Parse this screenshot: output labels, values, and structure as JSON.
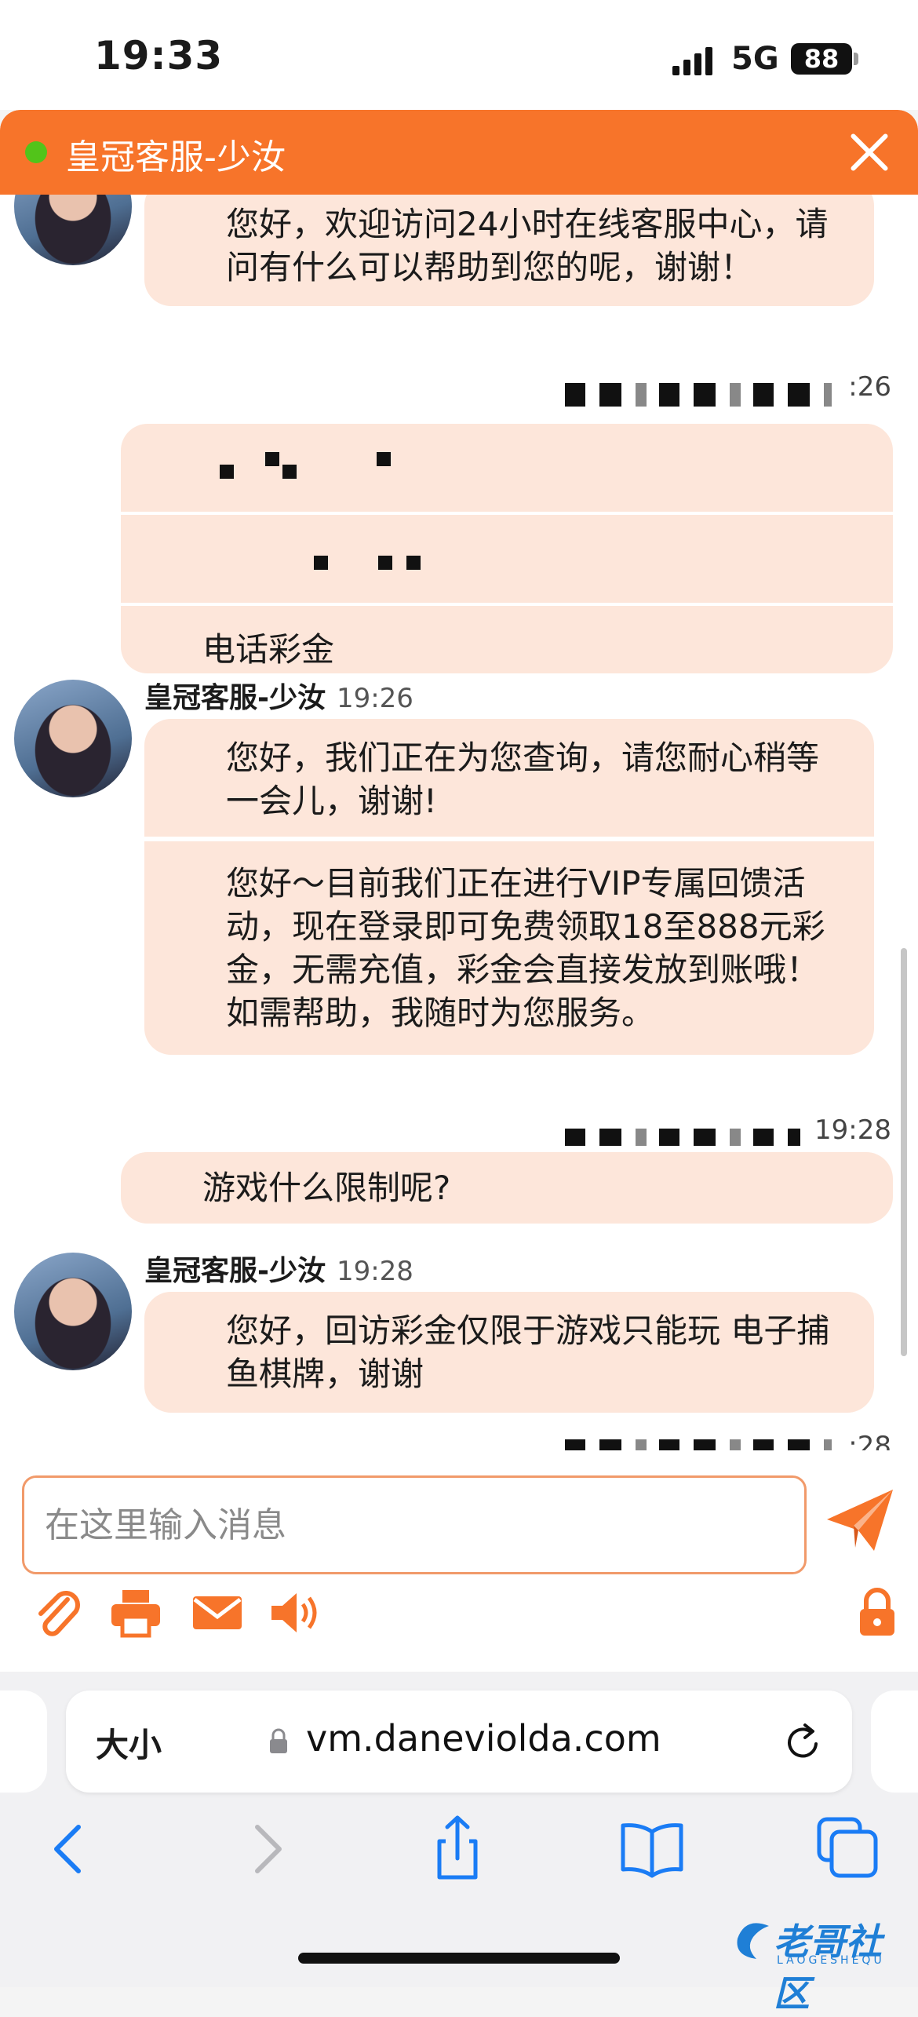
{
  "status_bar": {
    "time": "19:33",
    "network": "5G",
    "battery": "88"
  },
  "chat": {
    "header_title": "皇冠客服-少汝",
    "messages": {
      "agent_greeting": "您好，欢迎访问24小时在线客服中心，请问有什么可以帮助到您的呢，谢谢！",
      "user1_time_partial": ":26",
      "user1_text": "电话彩金",
      "agent2_name": "皇冠客服-少汝",
      "agent2_time": "19:26",
      "agent2_text1": "您好，我们正在为您查询，请您耐心稍等一会儿，谢谢!",
      "agent2_text2": "您好～目前我们正在进行VIP专属回馈活动，现在登录即可免费领取18至888元彩金，无需充值，彩金会直接发放到账哦！如需帮助，我随时为您服务。",
      "user2_time": "19:28",
      "user2_text": "游戏什么限制呢?",
      "agent3_name": "皇冠客服-少汝",
      "agent3_time": "19:28",
      "agent3_text": "您好，回访彩金仅限于游戏只能玩 电子捕鱼棋牌，谢谢",
      "user3_time_partial": ":28"
    },
    "input_placeholder": "在这里输入消息",
    "toolbar_icons": [
      "paperclip-icon",
      "printer-icon",
      "envelope-icon",
      "speaker-icon",
      "lock-icon"
    ],
    "accent_color": "#f7742a",
    "bubble_color": "#fde6da"
  },
  "browser": {
    "text_size_label": "大小",
    "url": "vm.daneviolda.com",
    "nav_icons": [
      "back-icon",
      "forward-icon",
      "share-icon",
      "bookmarks-icon",
      "tabs-icon"
    ]
  },
  "watermark": {
    "text": "老哥社区",
    "subtext": "LAOGESHEQU"
  }
}
